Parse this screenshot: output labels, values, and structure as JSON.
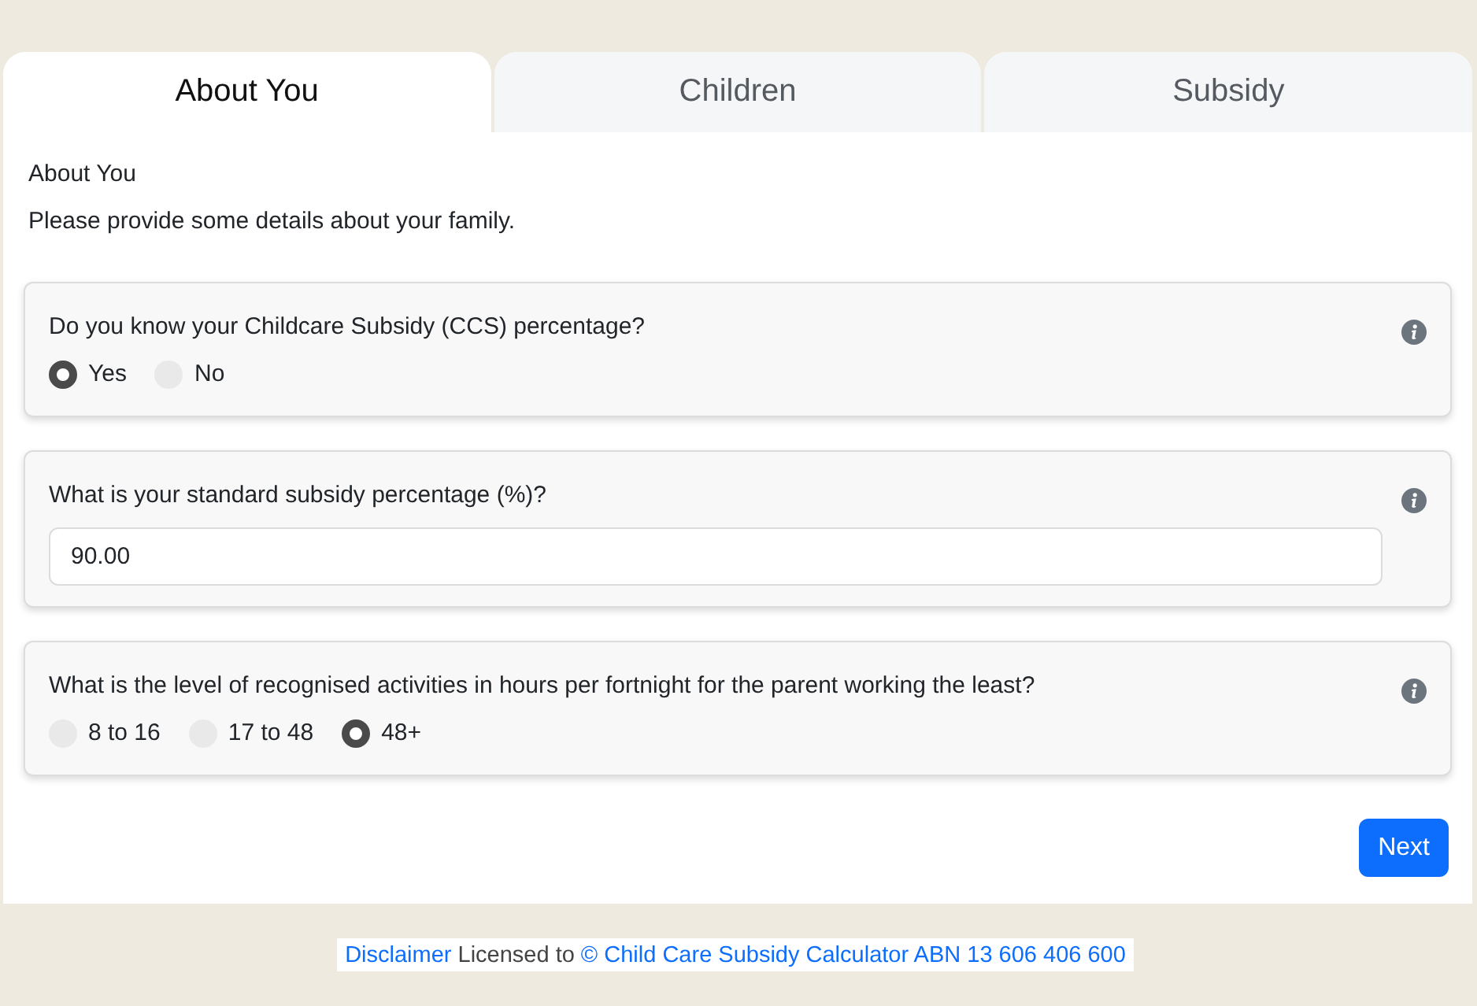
{
  "tabs": [
    {
      "label": "About You",
      "selected": true
    },
    {
      "label": "Children",
      "selected": false
    },
    {
      "label": "Subsidy",
      "selected": false
    }
  ],
  "section": {
    "title": "About You",
    "description": "Please provide some details about your family."
  },
  "questions": [
    {
      "kind": "radio",
      "text": "Do you know your Childcare Subsidy (CCS) percentage?",
      "options": [
        {
          "label": "Yes",
          "selected": true
        },
        {
          "label": "No",
          "selected": false
        }
      ]
    },
    {
      "kind": "input",
      "text": "What is your standard subsidy percentage (%)?",
      "value": "90.00"
    },
    {
      "kind": "radio",
      "text": "What is the level of recognised activities in hours per fortnight for the parent working the least?",
      "options": [
        {
          "label": "8 to 16",
          "selected": false
        },
        {
          "label": "17 to 48",
          "selected": false
        },
        {
          "label": "48+",
          "selected": true
        }
      ]
    }
  ],
  "next_button": {
    "label": "Next"
  },
  "footer": {
    "disclaimer_link": "Disclaimer",
    "license_text": "Licensed to",
    "owner_link": "© Child Care Subsidy Calculator ABN 13 606 406 600"
  }
}
